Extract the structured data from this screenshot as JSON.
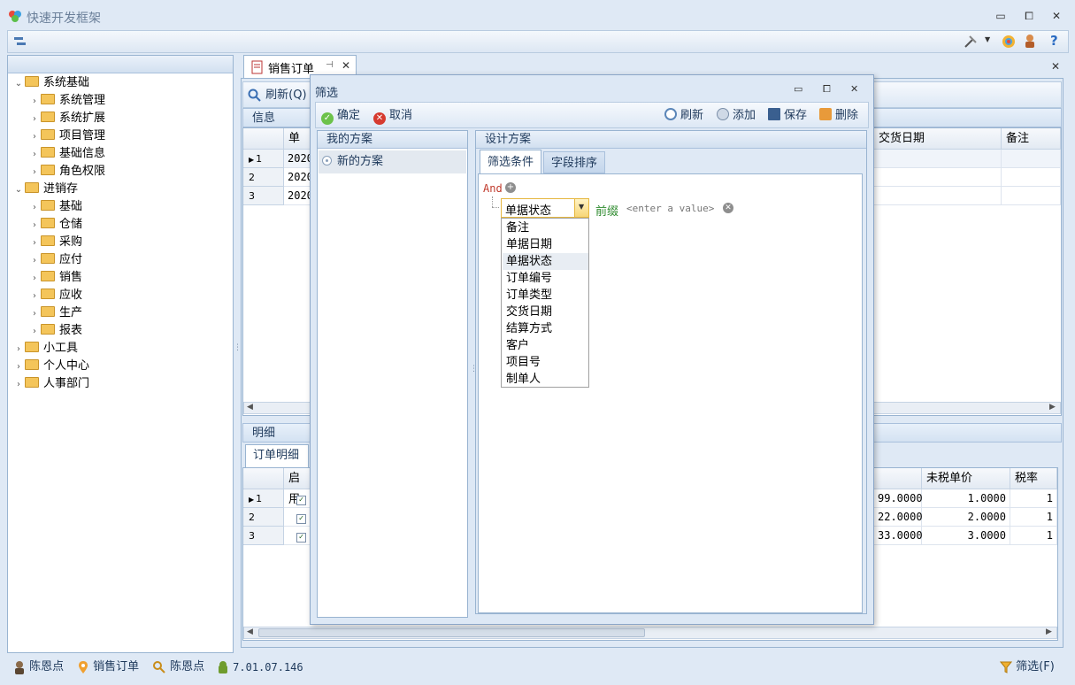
{
  "app": {
    "title": "快速开发框架"
  },
  "window_controls": {
    "minimize": "▭",
    "maximize": "⧠",
    "close": "✕"
  },
  "nav": {
    "tree": [
      {
        "label": "系统基础",
        "arrow": "⌄"
      },
      {
        "label": "系统管理",
        "arrow": "›"
      },
      {
        "label": "系统扩展",
        "arrow": "›"
      },
      {
        "label": "项目管理",
        "arrow": "›"
      },
      {
        "label": "基础信息",
        "arrow": "›"
      },
      {
        "label": "角色权限",
        "arrow": "›"
      },
      {
        "label": "进销存",
        "arrow": "⌄"
      },
      {
        "label": "基础",
        "arrow": "›"
      },
      {
        "label": "仓储",
        "arrow": "›"
      },
      {
        "label": "采购",
        "arrow": "›"
      },
      {
        "label": "应付",
        "arrow": "›"
      },
      {
        "label": "销售",
        "arrow": "›"
      },
      {
        "label": "应收",
        "arrow": "›"
      },
      {
        "label": "生产",
        "arrow": "›"
      },
      {
        "label": "报表",
        "arrow": "›"
      },
      {
        "label": "小工具",
        "arrow": "›"
      },
      {
        "label": "个人中心",
        "arrow": "›"
      },
      {
        "label": "人事部门",
        "arrow": "›"
      }
    ]
  },
  "doc": {
    "tab_label": "销售订单",
    "refresh_label": "刷新(Q)",
    "info_section": "信息",
    "master_grid": {
      "col_doc": "单据",
      "col_delivery": "交货日期",
      "col_remark": "备注",
      "rows": [
        {
          "idx": "1",
          "doc": "2020"
        },
        {
          "idx": "2",
          "doc": "2020"
        },
        {
          "idx": "3",
          "doc": "2020"
        }
      ]
    },
    "detail_section": "明细",
    "detail_tab": "订单明细",
    "detail_grid": {
      "col_enabled": "启用",
      "col_unit_price": "未税单价",
      "col_tax_rate": "税率",
      "rows": [
        {
          "idx": "1",
          "amount": "99.0000",
          "price": "1.0000",
          "tax": "1"
        },
        {
          "idx": "2",
          "amount": "22.0000",
          "price": "2.0000",
          "tax": "1"
        },
        {
          "idx": "3",
          "amount": "33.0000",
          "price": "3.0000",
          "tax": "1"
        }
      ]
    }
  },
  "dialog": {
    "title": "筛选",
    "confirm": "确定",
    "cancel": "取消",
    "refresh": "刷新",
    "add": "添加",
    "save": "保存",
    "delete": "删除",
    "my_plans": "我的方案",
    "new_plan": "新的方案",
    "design_plan": "设计方案",
    "tab_filter": "筛选条件",
    "tab_sort": "字段排序",
    "and_label": "And",
    "field_value": "单据状态",
    "operator": "前缀",
    "value_placeholder": "<enter a value>",
    "options": [
      "备注",
      "单据日期",
      "单据状态",
      "订单编号",
      "订单类型",
      "交货日期",
      "结算方式",
      "客户",
      "项目号",
      "制单人"
    ]
  },
  "status": {
    "user": "陈恩点",
    "module": "销售订单",
    "user2": "陈恩点",
    "version": "7.01.07.146",
    "filter": "筛选(F)"
  }
}
